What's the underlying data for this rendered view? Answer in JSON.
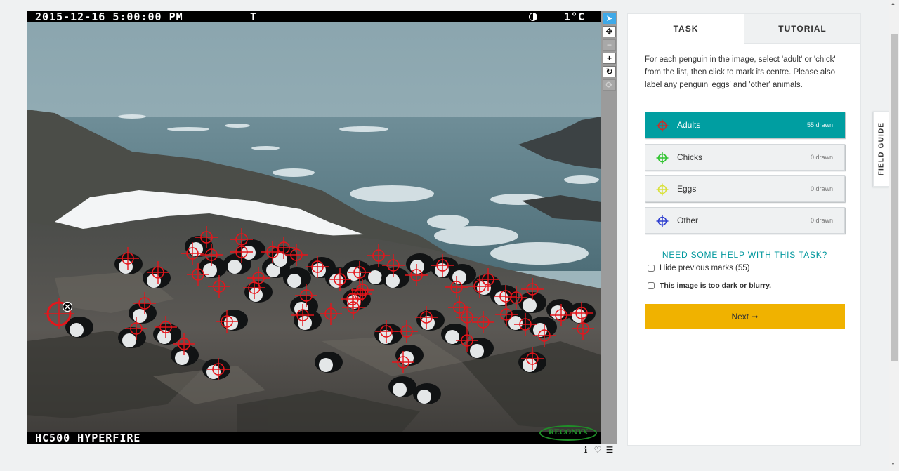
{
  "camera": {
    "timestamp": "2015-12-16 5:00:00 PM",
    "flag": "T",
    "temperature": "1°C",
    "model": "HC500 HYPERFIRE",
    "brand": "RECONYX"
  },
  "tools": [
    {
      "name": "pointer-icon",
      "glyph": "➤",
      "state": "active"
    },
    {
      "name": "move-icon",
      "glyph": "✥",
      "state": "normal"
    },
    {
      "name": "zoom-out-icon",
      "glyph": "−",
      "state": "disabled"
    },
    {
      "name": "zoom-in-icon",
      "glyph": "+",
      "state": "normal"
    },
    {
      "name": "rotate-icon",
      "glyph": "↻",
      "state": "normal"
    },
    {
      "name": "reset-icon",
      "glyph": "⟳",
      "state": "disabled"
    }
  ],
  "meta_icons": [
    "info-icon",
    "heart-icon",
    "list-icon"
  ],
  "tabs": [
    {
      "label": "TASK",
      "active": true
    },
    {
      "label": "TUTORIAL",
      "active": false
    }
  ],
  "task": {
    "instructions": "For each penguin in the image, select 'adult' or 'chick' from the list, then click to mark its centre. Please also label any penguin 'eggs' and 'other' animals.",
    "options": [
      {
        "label": "Adults",
        "count": "55 drawn",
        "color": "#c4312b",
        "selected": true
      },
      {
        "label": "Chicks",
        "count": "0 drawn",
        "color": "#2ec42e",
        "selected": false
      },
      {
        "label": "Eggs",
        "count": "0 drawn",
        "color": "#d9e13a",
        "selected": false
      },
      {
        "label": "Other",
        "count": "0 drawn",
        "color": "#2f3fd0",
        "selected": false
      }
    ],
    "help_link": "NEED SOME HELP WITH THIS TASK?",
    "hide_marks_label": "Hide previous marks (55)",
    "too_dark_label": "This image is too dark or blurry.",
    "next_label": "Next ➞"
  },
  "field_guide": "FIELD GUIDE",
  "colors": {
    "accent": "#009ea1",
    "next_button": "#f0b200",
    "mark": "#e5151b"
  }
}
